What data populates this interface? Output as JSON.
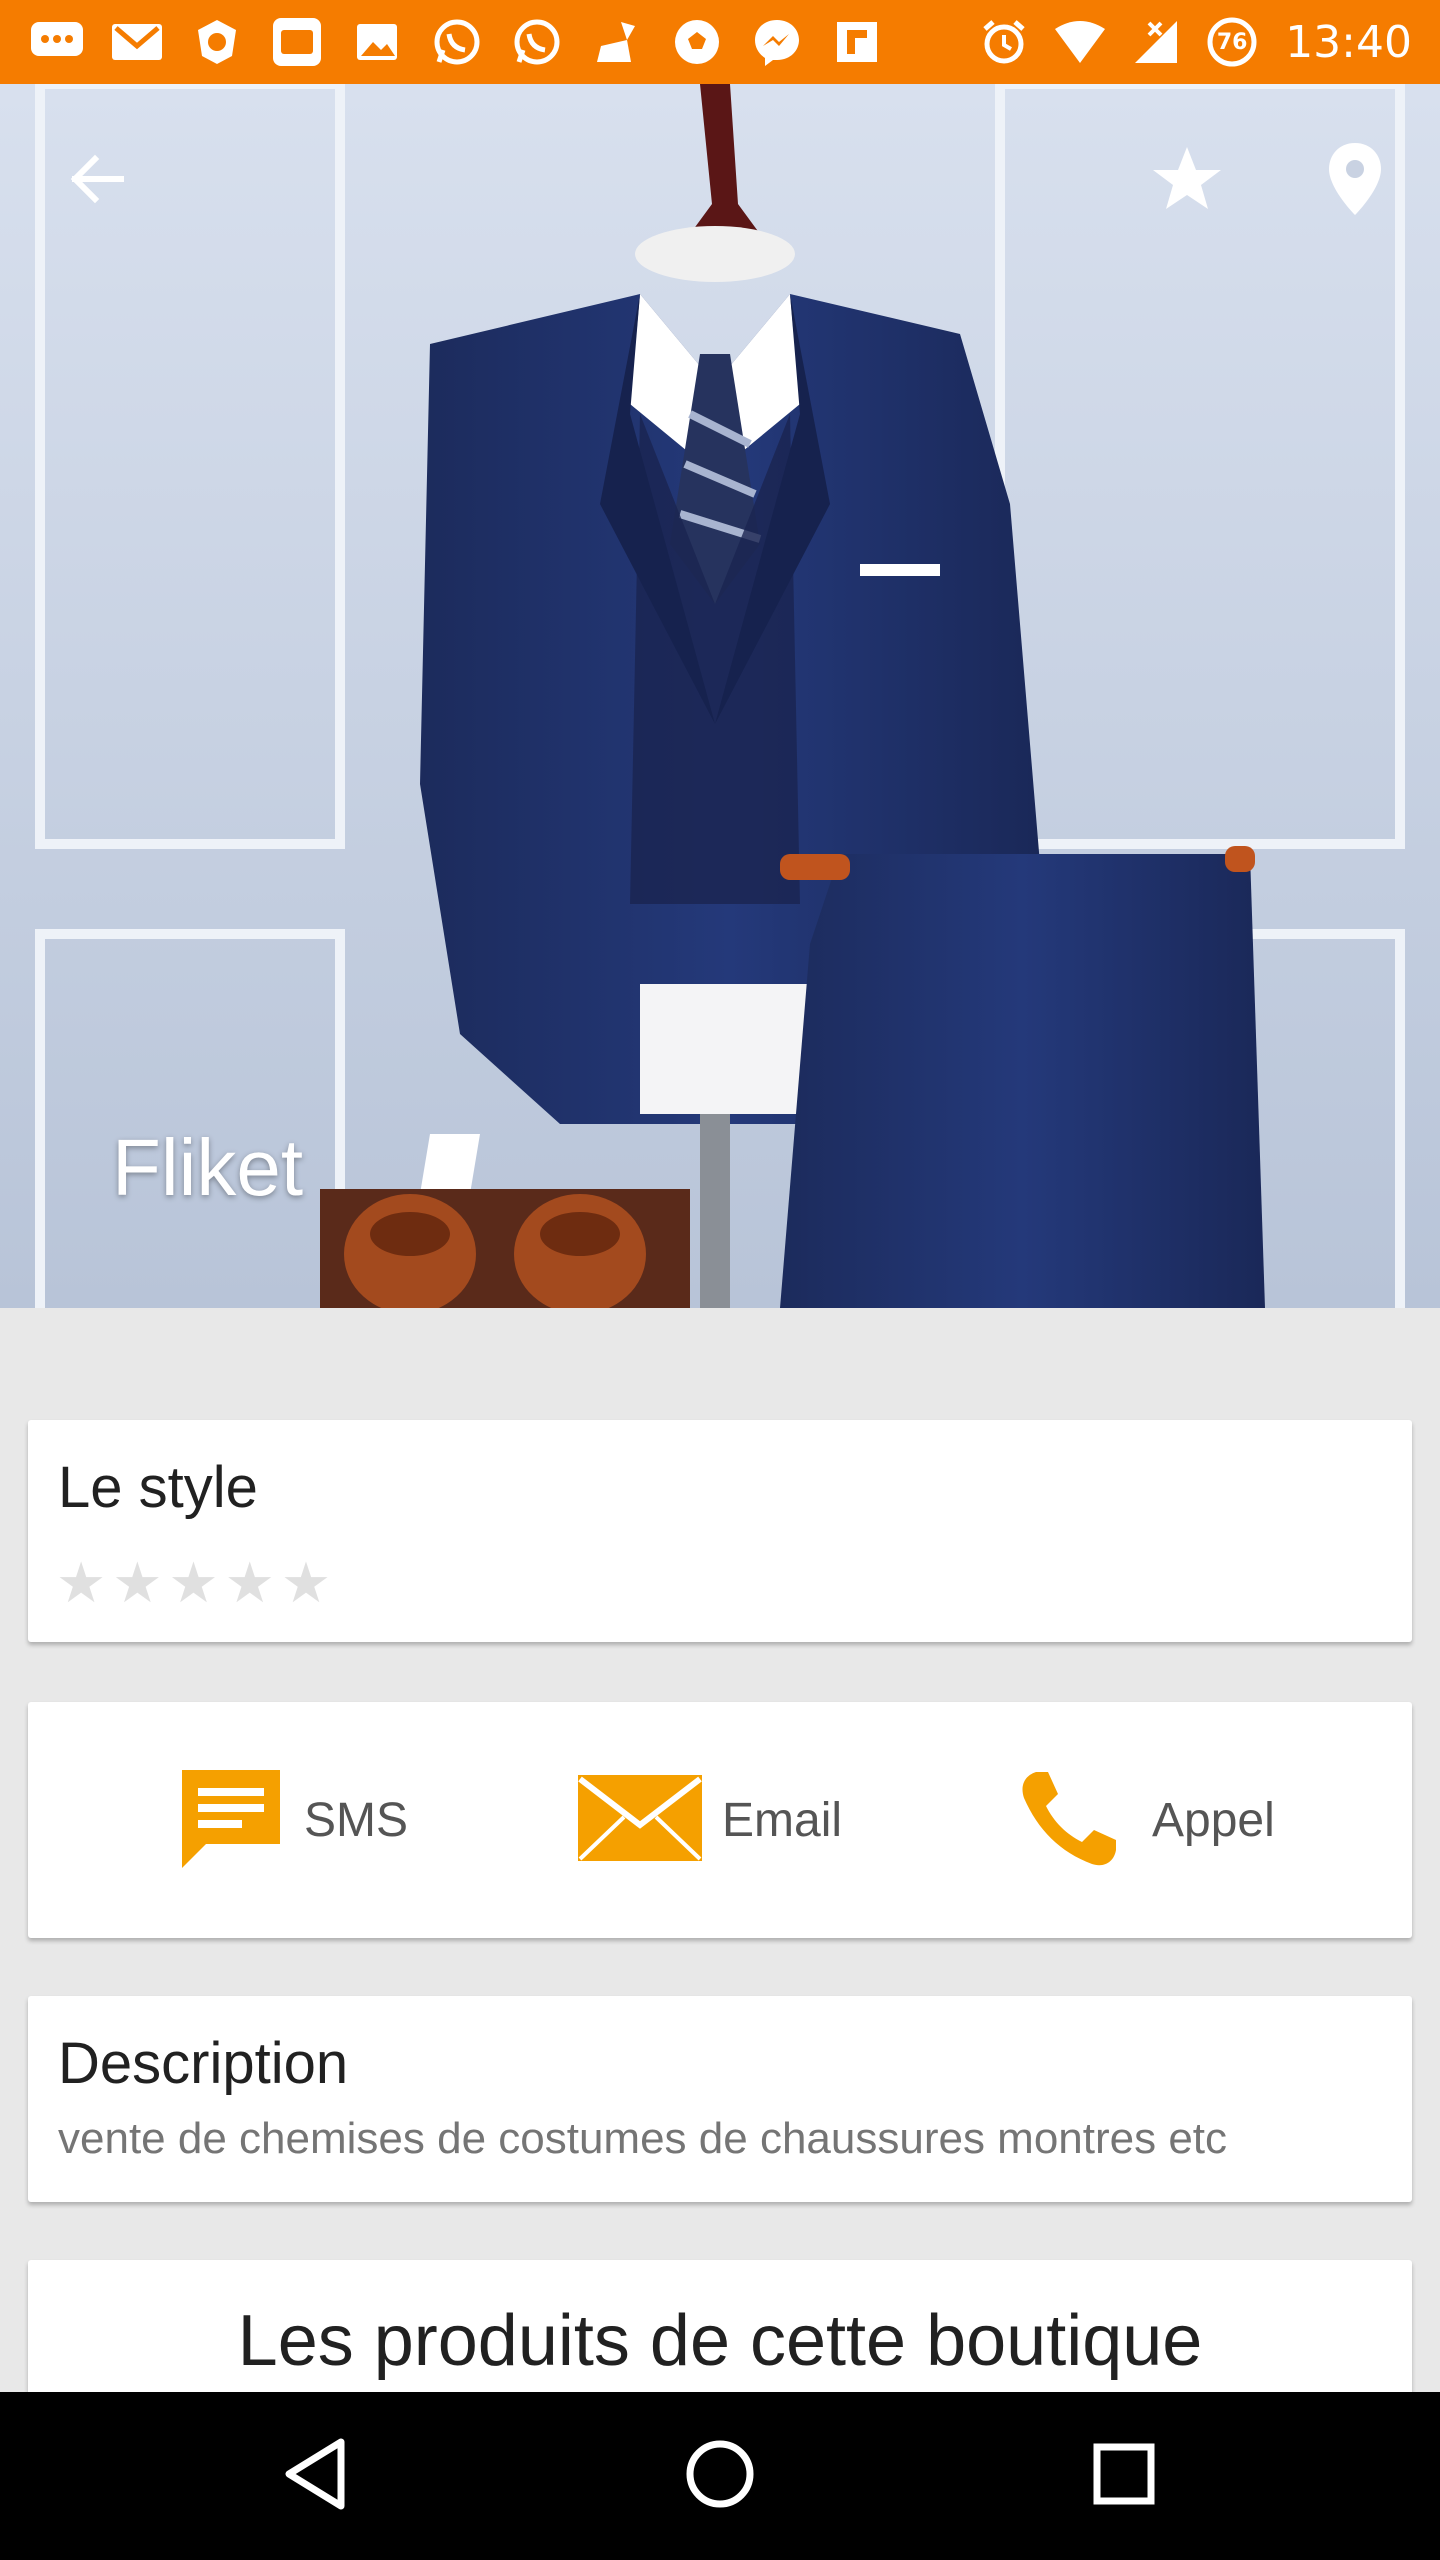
{
  "status_bar": {
    "time": "13:40",
    "battery_level": "76",
    "notification_icons": [
      "messages-icon",
      "gmail-icon",
      "app-icon",
      "app-icon",
      "gallery-icon",
      "whatsapp-icon",
      "whatsapp-icon",
      "cleaner-icon",
      "soccer-icon",
      "messenger-icon",
      "flipboard-icon"
    ],
    "system_icons": [
      "alarm-icon",
      "wifi-icon",
      "signal-icon",
      "battery-icon"
    ],
    "color": "#f57c00"
  },
  "hero": {
    "title": "Fliket",
    "back_icon": "arrow-back-icon",
    "favorite_icon": "star-icon",
    "location_icon": "location-pin-icon"
  },
  "style_card": {
    "title": "Le style",
    "rating": 0,
    "max_rating": 5
  },
  "contact": {
    "sms_label": "SMS",
    "email_label": "Email",
    "call_label": "Appel",
    "accent_color": "#f5a000"
  },
  "description": {
    "title": "Description",
    "text": "vente de chemises de costumes de chaussures montres etc"
  },
  "products": {
    "title": "Les produits de cette boutique"
  },
  "nav_bar": {
    "icons": [
      "nav-back-icon",
      "nav-home-icon",
      "nav-recent-icon"
    ]
  }
}
